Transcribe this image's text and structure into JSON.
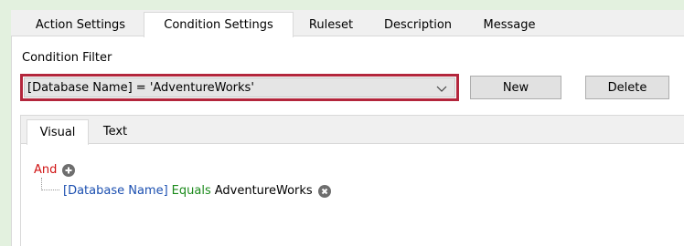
{
  "tabs": [
    {
      "label": "Action Settings"
    },
    {
      "label": "Condition Settings"
    },
    {
      "label": "Ruleset"
    },
    {
      "label": "Description"
    },
    {
      "label": "Message"
    }
  ],
  "condition_filter": {
    "label": "Condition Filter",
    "value": "[Database Name] = 'AdventureWorks'",
    "new_label": "New",
    "delete_label": "Delete"
  },
  "inner_tabs": [
    {
      "label": "Visual"
    },
    {
      "label": "Text"
    }
  ],
  "tree": {
    "operator": "And",
    "condition": {
      "field": "[Database Name]",
      "op": "Equals",
      "value": "AdventureWorks"
    }
  },
  "colors": {
    "highlight_border": "#b3263c",
    "operator_red": "#d01212",
    "field_blue": "#1b4fb0",
    "op_green": "#1b8a1b"
  },
  "icons": {
    "add": "plus-circle-icon",
    "remove": "x-circle-icon",
    "dropdown": "chevron-down-icon"
  }
}
